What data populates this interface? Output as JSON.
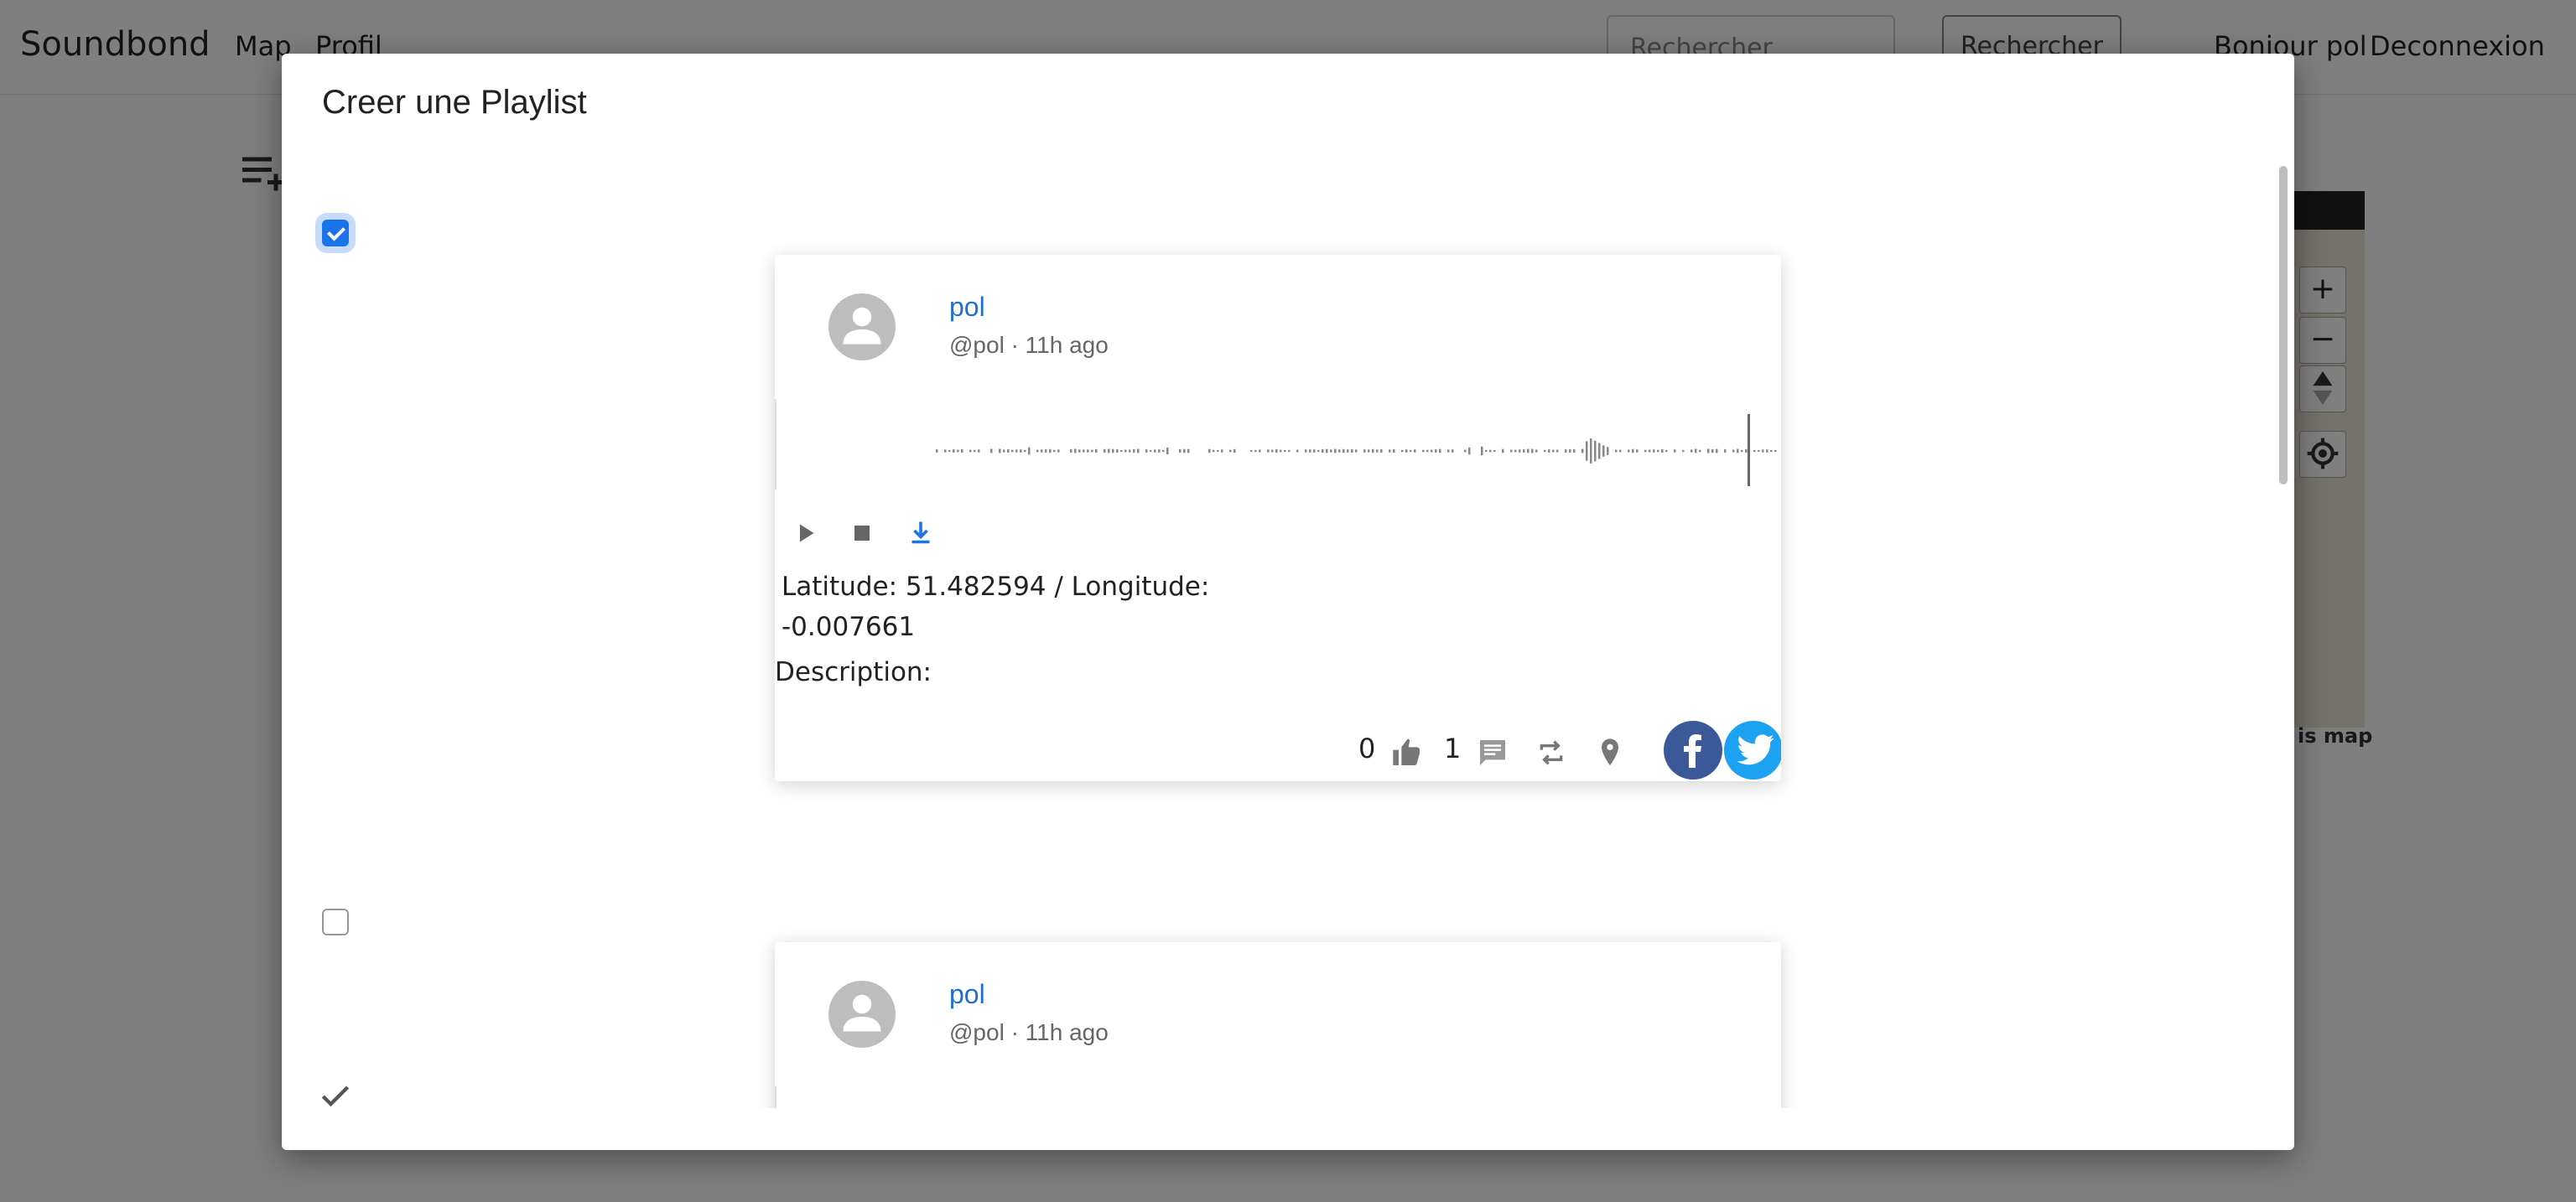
{
  "navbar": {
    "brand": "Soundbond",
    "links": [
      "Map",
      "Profil"
    ],
    "search_placeholder": "Rechercher",
    "search_button": "Rechercher",
    "greeting": "Bonjour pol",
    "logout": "Deconnexion"
  },
  "map": {
    "caption": "is map",
    "zoom_in": "+",
    "zoom_out": "−"
  },
  "modal": {
    "title": "Creer une Playlist",
    "items": [
      {
        "checked": true,
        "name": "pol",
        "handle": "@pol · 11h ago",
        "coords_line1": "Latitude: 51.482594 / Longitude:",
        "coords_line2": "-0.007661",
        "description": "Description:",
        "likes": "0",
        "comments": "1"
      },
      {
        "checked": false,
        "name": "pol",
        "handle": "@pol · 11h ago"
      }
    ]
  },
  "colors": {
    "accent": "#1a73e8",
    "link": "#1e6fd1",
    "facebook": "#3b5998",
    "twitter": "#1da1f2"
  }
}
